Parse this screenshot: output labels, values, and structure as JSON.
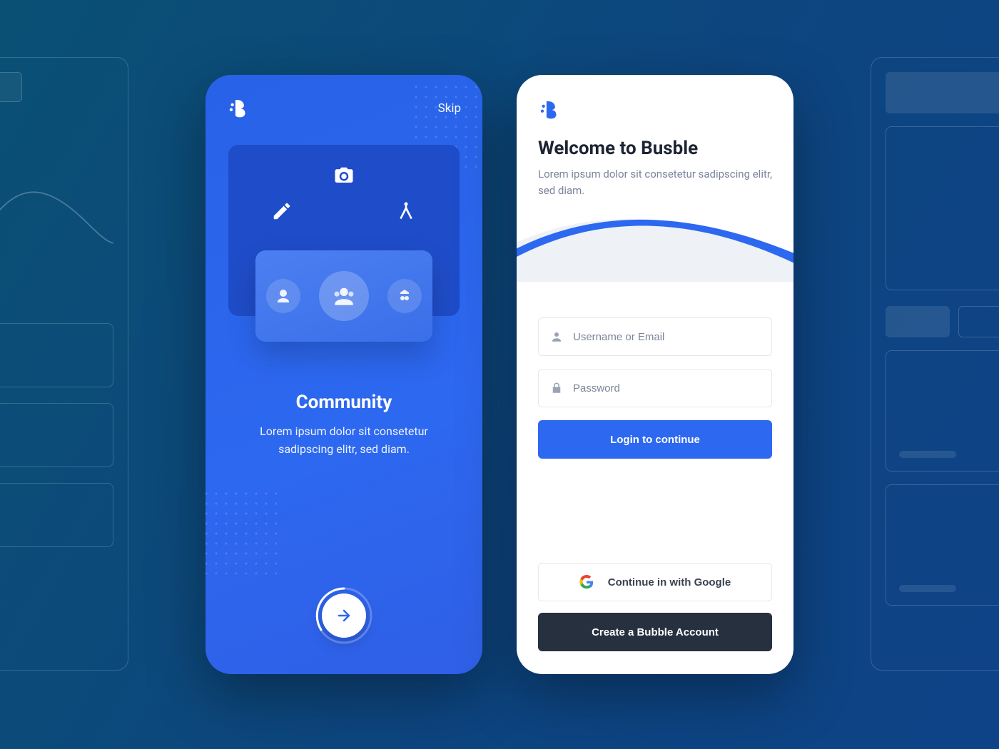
{
  "brand": {
    "name": "Busble"
  },
  "onboarding": {
    "skip_label": "Skip",
    "title": "Community",
    "description": "Lorem ipsum dolor sit consetetur sadipscing elitr, sed diam.",
    "illustration": {
      "top_icons": [
        "camera-icon",
        "pencil-icon",
        "compass-icon"
      ],
      "avatars": [
        "astronaut-icon",
        "group-icon",
        "spy-icon"
      ]
    }
  },
  "login": {
    "title": "Welcome to Busble",
    "description": "Lorem ipsum dolor sit consetetur sadipscing elitr, sed diam.",
    "username_placeholder": "Username or Email",
    "password_placeholder": "Password",
    "login_button": "Login to continue",
    "google_button": "Continue in with Google",
    "create_button": "Create a Bubble Account"
  },
  "colors": {
    "primary": "#2d68f0",
    "dark": "#27303f",
    "text_muted": "#7a8599"
  }
}
